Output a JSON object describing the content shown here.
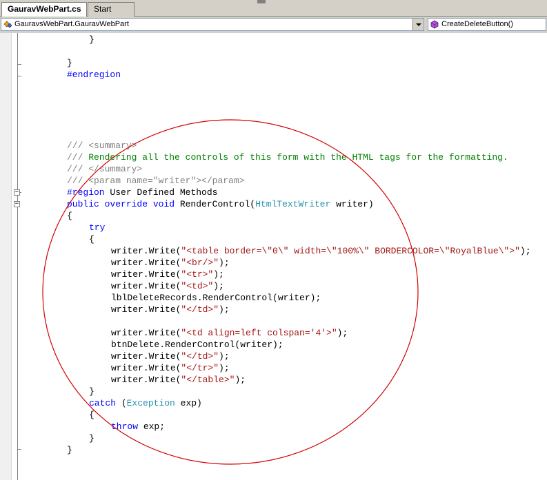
{
  "tabs": [
    {
      "label": "GauravWebPart.cs",
      "active": true
    },
    {
      "label": "Start Page",
      "active": false
    }
  ],
  "navbar": {
    "type_selector": "GauravsWebPart.GauravWebPart",
    "member_selector": "CreateDeleteButton()"
  },
  "code_lines": {
    "l01": "}",
    "l02": "}",
    "l03_kw": "#endregion",
    "l04_a": "/// ",
    "l04_b": "<summary>",
    "l05_a": "/// ",
    "l05_b": "Rendering all the controls of this form with the HTML tags for the formatting.",
    "l06_a": "/// ",
    "l06_b": "</summary>",
    "l07_a": "/// ",
    "l07_b": "<param name=\"writer\"></param>",
    "l08_kw": "#region",
    "l08_rest": " User Defined Methods",
    "l09_kw": "public override void",
    "l09_a": " RenderControl(",
    "l09_ty": "HtmlTextWriter",
    "l09_b": " writer)",
    "l10": "{",
    "l11_kw": "try",
    "l12": "{",
    "l13_a": "writer.Write(",
    "l13_s": "\"<table border=\\\"0\\\" width=\\\"100%\\\" BORDERCOLOR=\\\"RoyalBlue\\\">\"",
    "l13_b": ");",
    "l14_a": "writer.Write(",
    "l14_s": "\"<br/>\"",
    "l14_b": ");",
    "l15_a": "writer.Write(",
    "l15_s": "\"<tr>\"",
    "l15_b": ");",
    "l16_a": "writer.Write(",
    "l16_s": "\"<td>\"",
    "l16_b": ");",
    "l17": "lblDeleteRecords.RenderControl(writer);",
    "l18_a": "writer.Write(",
    "l18_s": "\"</td>\"",
    "l18_b": ");",
    "l19_a": "writer.Write(",
    "l19_s": "\"<td align=left colspan='4'>\"",
    "l19_b": ");",
    "l20": "btnDelete.RenderControl(writer);",
    "l21_a": "writer.Write(",
    "l21_s": "\"</td>\"",
    "l21_b": ");",
    "l22_a": "writer.Write(",
    "l22_s": "\"</tr>\"",
    "l22_b": ");",
    "l23_a": "writer.Write(",
    "l23_s": "\"</table>\"",
    "l23_b": ");",
    "l24": "}",
    "l25_kw": "catch",
    "l25_a": " (",
    "l25_ty": "Exception",
    "l25_b": " exp)",
    "l26": "{",
    "l27_kw": "throw",
    "l27_a": " exp;",
    "l28": "}",
    "l29": "}"
  },
  "colors": {
    "keyword": "#0000ff",
    "type": "#2b91af",
    "string": "#a31515",
    "comment": "#008000",
    "xml_doc": "#808080",
    "annotation_circle": "#d40000"
  },
  "icons": {
    "type_selector": "class-icon",
    "member_selector": "method-icon"
  }
}
